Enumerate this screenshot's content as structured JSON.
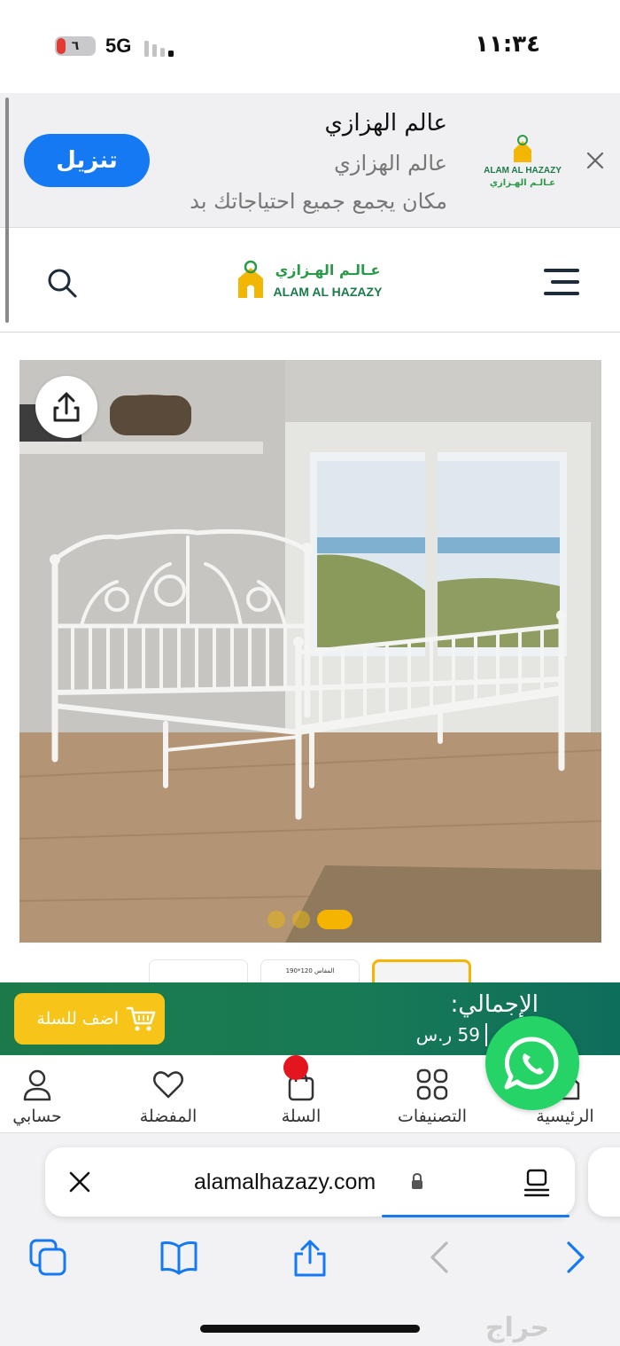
{
  "status_bar": {
    "battery": "٦",
    "network": "5G",
    "clock": "١١:٣٤"
  },
  "app_banner": {
    "install_label": "تنزيل",
    "title": "عالم الهزازي",
    "subtitle": "عالم الهزازي",
    "description": "مكان يجمع جميع احتياجاتك بد",
    "logo_text_en": "ALAM AL HAZAZY",
    "logo_text_ar": "عـالـم الهـزازي"
  },
  "site_header": {
    "logo_text_ar": "عـالـم الهـزازي",
    "logo_text_en": "ALAM AL HAZAZY"
  },
  "gallery": {
    "slide_count": 3,
    "active_slide": 3,
    "thumb_caption": "المقاس 120*190"
  },
  "cart_bar": {
    "add_to_cart_label": "اضف للسلة",
    "total_label": "الإجمالي:",
    "total_value": "59 ر.س"
  },
  "bottom_nav": {
    "items": [
      {
        "label": "حسابي",
        "icon": "user-icon"
      },
      {
        "label": "المفضلة",
        "icon": "heart-icon"
      },
      {
        "label": "السلة",
        "icon": "cart-icon"
      },
      {
        "label": "التصنيفات",
        "icon": "grid-icon"
      },
      {
        "label": "الرئيسية",
        "icon": "home-icon"
      }
    ]
  },
  "browser": {
    "url": "alamalhazazy.com",
    "watermark": "حراج"
  },
  "colors": {
    "install_blue": "#1479f2",
    "brand_green": "#1c7a4a",
    "brand_yellow": "#f7c519",
    "whatsapp_green": "#25d366",
    "badge_red": "#e3151f"
  }
}
